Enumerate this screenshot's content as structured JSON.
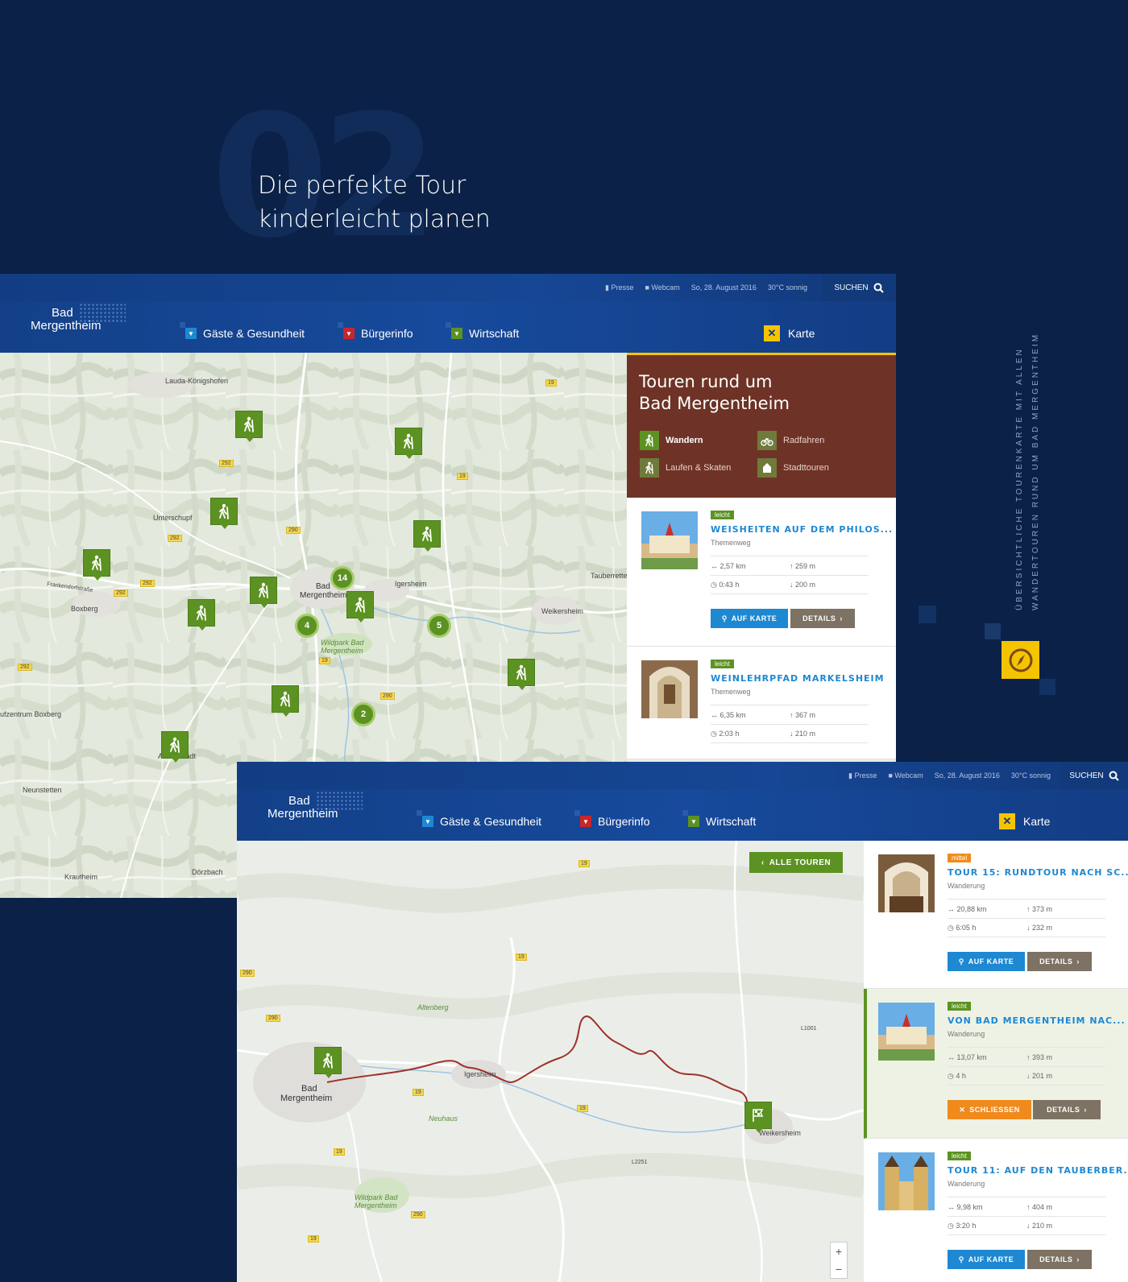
{
  "hero": {
    "number": "02",
    "title_line1": "Die perfekte Tour",
    "title_line2": "kinderleicht planen"
  },
  "side_caption": {
    "line1": "ÜBERSICHTLICHE TOURENKARTE MIT ALLEN",
    "line2": "WANDERTOUREN RUND UM BAD MERGENTHEIM"
  },
  "header": {
    "presse": "Presse",
    "webcam": "Webcam",
    "date": "So, 28. August 2016",
    "weather": "30°C sonnig",
    "search": "SUCHEN",
    "logo_line1": "Bad",
    "logo_line2": "Mergentheim",
    "nav": [
      "Gäste & Gesundheit",
      "Bürgerinfo",
      "Wirtschaft"
    ],
    "karte": "Karte",
    "colors": {
      "nav1": "#1e88d2",
      "nav2": "#c8262b",
      "nav3": "#5c9222",
      "accent": "#f5c400"
    }
  },
  "map1": {
    "labels": [
      "Lauda-Königshofen",
      "Unterschupf",
      "Boxberg",
      "Bad",
      "Mergentheim",
      "Igersheim",
      "Tauberrette",
      "Weikersheim",
      "Wildpark Bad",
      "Mergentheim",
      "ufzentrum Boxberg",
      "Assamstadt",
      "Neunstetten",
      "Krautheim",
      "Dörzbach",
      "Frankendorfstraße"
    ],
    "clusters": [
      "14",
      "4",
      "5",
      "2"
    ]
  },
  "panel": {
    "title_line1": "Touren rund um",
    "title_line2": "Bad Mergentheim",
    "categories": [
      "Wandern",
      "Radfahren",
      "Laufen & Skaten",
      "Stadttouren"
    ]
  },
  "tours1": [
    {
      "level": "leicht",
      "title": "WEISHEITEN AUF DEM PHILOS...",
      "type": "Themenweg",
      "distance": "2,57 km",
      "ascent": "259 m",
      "duration": "0:43 h",
      "descent": "200 m",
      "btn_map": "AUF KARTE",
      "btn_details": "DETAILS"
    },
    {
      "level": "leicht",
      "title": "WEINLEHRPFAD MARKELSHEIM",
      "type": "Themenweg",
      "distance": "6,35 km",
      "ascent": "367 m",
      "duration": "2:03 h",
      "descent": "210 m"
    }
  ],
  "map2": {
    "alle_touren": "ALLE TOUREN",
    "labels": [
      "Altenberg",
      "Bad",
      "Mergentheim",
      "Igersheim",
      "Neuhaus",
      "Weikersheim",
      "Wildpark Bad",
      "Mergentheim",
      "L2251",
      "L1001"
    ],
    "zoom_in": "+",
    "zoom_out": "−"
  },
  "tours2": [
    {
      "level": "mittel",
      "title": "TOUR 15: RUNDTOUR NACH SC...",
      "type": "Wanderung",
      "distance": "20,88 km",
      "ascent": "373 m",
      "duration": "6:05 h",
      "descent": "232 m",
      "btn_map": "AUF KARTE",
      "btn_details": "DETAILS"
    },
    {
      "level": "leicht",
      "title": "VON BAD MERGENTHEIM NAC...",
      "type": "Wanderung",
      "distance": "13,07 km",
      "ascent": "393 m",
      "duration": "4 h",
      "descent": "201 m",
      "btn_close": "SCHLIESSEN",
      "btn_details": "DETAILS"
    },
    {
      "level": "leicht",
      "title": "TOUR 11: AUF DEN TAUBERBER...",
      "type": "Wanderung",
      "distance": "9,98 km",
      "ascent": "404 m",
      "duration": "3:20 h",
      "descent": "210 m",
      "btn_map": "AUF KARTE",
      "btn_details": "DETAILS"
    }
  ]
}
